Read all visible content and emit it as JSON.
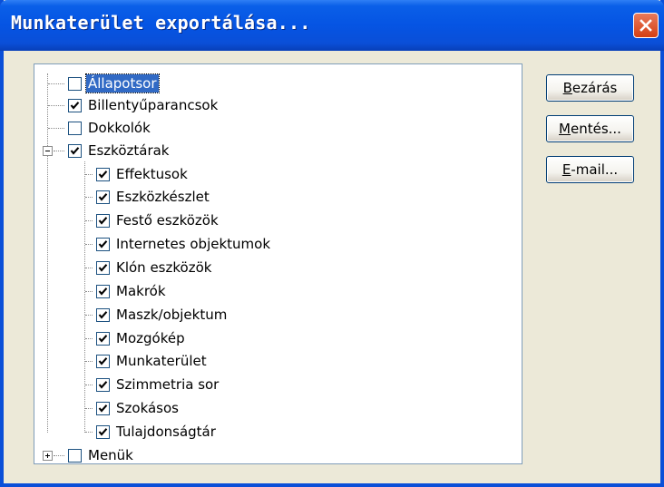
{
  "window": {
    "title": "Munkaterület exportálása..."
  },
  "tree": {
    "items": [
      {
        "label": "Állapotsor",
        "checked": false,
        "selected": true
      },
      {
        "label": "Billentyűparancsok",
        "checked": true
      },
      {
        "label": "Dokkolók",
        "checked": false
      },
      {
        "label": "Eszköztárak",
        "checked": true,
        "expanded": true
      },
      {
        "label": "Effektusok",
        "checked": true
      },
      {
        "label": "Eszközkészlet",
        "checked": true
      },
      {
        "label": "Festő eszközök",
        "checked": true
      },
      {
        "label": "Internetes objektumok",
        "checked": true
      },
      {
        "label": "Klón eszközök",
        "checked": true
      },
      {
        "label": "Makrók",
        "checked": true
      },
      {
        "label": "Maszk/objektum",
        "checked": true
      },
      {
        "label": "Mozgókép",
        "checked": true
      },
      {
        "label": "Munkaterület",
        "checked": true
      },
      {
        "label": "Szimmetria sor",
        "checked": true
      },
      {
        "label": "Szokásos",
        "checked": true
      },
      {
        "label": "Tulajdonságtár",
        "checked": true
      },
      {
        "label": "Menük",
        "checked": false,
        "expanded": false
      }
    ]
  },
  "buttons": {
    "close": {
      "mnemonic": "B",
      "rest": "ezárás"
    },
    "save": {
      "mnemonic": "M",
      "rest": "entés..."
    },
    "email": {
      "mnemonic": "E",
      "rest": "-mail..."
    }
  },
  "icons": {
    "check": "checkmark-icon",
    "close": "close-icon",
    "expand": "plus-icon",
    "collapse": "minus-icon"
  },
  "colors": {
    "titlebar": "#0554e3",
    "selection": "#316ac5",
    "close_button": "#d43f13",
    "face": "#ece9d8"
  }
}
